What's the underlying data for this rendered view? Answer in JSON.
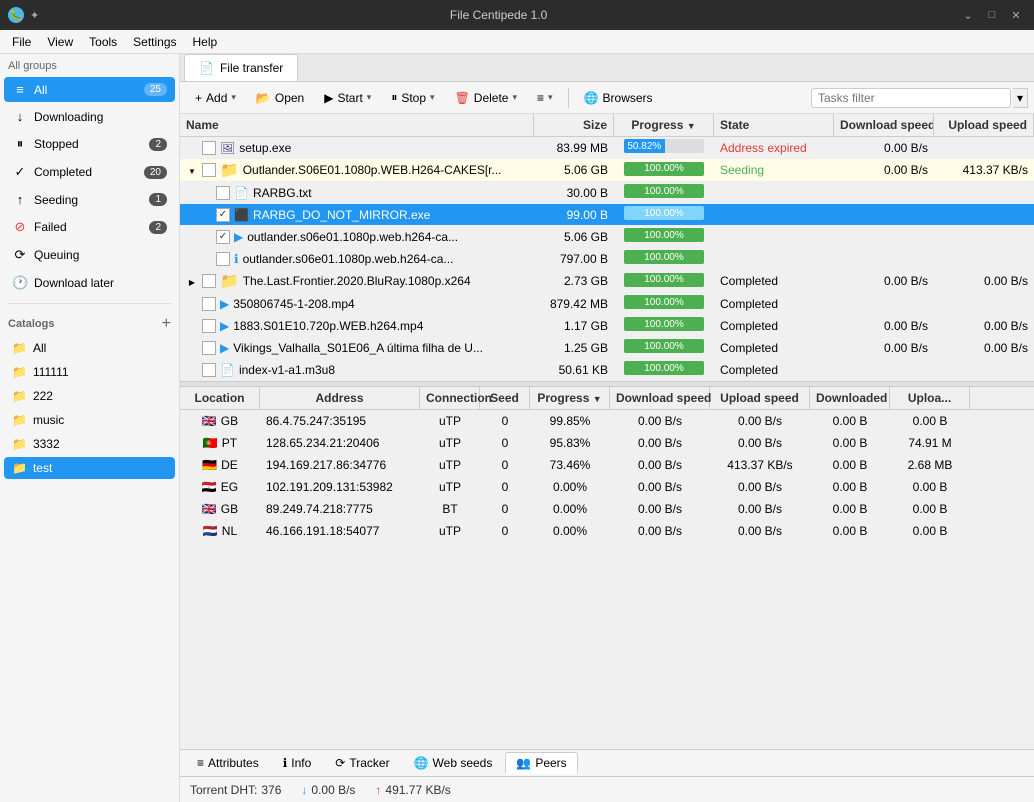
{
  "titleBar": {
    "title": "File Centipede 1.0",
    "controls": [
      "minimize",
      "maximize",
      "close"
    ]
  },
  "menuBar": {
    "items": [
      "File",
      "View",
      "Tools",
      "Settings",
      "Help"
    ]
  },
  "sidebar": {
    "groupLabel": "All groups",
    "navItems": [
      {
        "id": "all",
        "label": "All",
        "badge": "25",
        "active": true,
        "icon": "≡"
      },
      {
        "id": "downloading",
        "label": "Downloading",
        "badge": "",
        "active": false,
        "icon": "↓"
      },
      {
        "id": "stopped",
        "label": "Stopped",
        "badge": "2",
        "active": false,
        "icon": "⏸"
      },
      {
        "id": "completed",
        "label": "Completed",
        "badge": "20",
        "active": false,
        "icon": "✓"
      },
      {
        "id": "seeding",
        "label": "Seeding",
        "badge": "1",
        "active": false,
        "icon": "↑"
      },
      {
        "id": "failed",
        "label": "Failed",
        "badge": "2",
        "active": false,
        "icon": "⊘"
      },
      {
        "id": "queuing",
        "label": "Queuing",
        "badge": "",
        "active": false,
        "icon": "⟳"
      },
      {
        "id": "download-later",
        "label": "Download later",
        "badge": "",
        "active": false,
        "icon": "🕐"
      }
    ],
    "catalogs": {
      "title": "Catalogs",
      "addBtn": "+",
      "items": [
        {
          "id": "all",
          "label": "All",
          "active": false
        },
        {
          "id": "111111",
          "label": "111111",
          "active": false
        },
        {
          "id": "222",
          "label": "222",
          "active": false
        },
        {
          "id": "music",
          "label": "music",
          "active": false
        },
        {
          "id": "3332",
          "label": "3332",
          "active": false
        },
        {
          "id": "test",
          "label": "test",
          "active": true
        }
      ]
    }
  },
  "tab": {
    "label": "File transfer"
  },
  "toolbar": {
    "addLabel": "Add",
    "openLabel": "Open",
    "startLabel": "Start",
    "stopLabel": "Stop",
    "deleteLabel": "Delete",
    "moreLabel": "≡",
    "browsersLabel": "Browsers",
    "filterPlaceholder": "Tasks filter"
  },
  "tableHeaders": {
    "name": "Name",
    "size": "Size",
    "progress": "Progress",
    "state": "State",
    "dlSpeed": "Download speed",
    "ulSpeed": "Upload speed"
  },
  "tableRows": [
    {
      "id": 1,
      "indent": 0,
      "expand": false,
      "checkbox": false,
      "icon": "exe",
      "name": "setup.exe",
      "size": "83.99 MB",
      "progress": "50.82%",
      "progressVal": 50.82,
      "state": "Address expired",
      "dlSpeed": "0.00 B/s",
      "ulSpeed": "",
      "selected": false,
      "partial": true
    },
    {
      "id": 2,
      "indent": 0,
      "expand": true,
      "checkbox": false,
      "icon": "folder",
      "name": "Outlander.S06E01.1080p.WEB.H264-CAKES[r...",
      "size": "5.06 GB",
      "progress": "100.00%",
      "progressVal": 100,
      "state": "Seeding",
      "dlSpeed": "0.00 B/s",
      "ulSpeed": "413.37 KB/s",
      "selected": false,
      "partial": false
    },
    {
      "id": 3,
      "indent": 1,
      "expand": false,
      "checkbox": false,
      "icon": "text",
      "name": "RARBG.txt",
      "size": "30.00 B",
      "progress": "100.00%",
      "progressVal": 100,
      "state": "",
      "dlSpeed": "",
      "ulSpeed": "",
      "selected": false,
      "partial": false
    },
    {
      "id": 4,
      "indent": 1,
      "expand": false,
      "checkbox": true,
      "icon": "exe",
      "name": "RARBG_DO_NOT_MIRROR.exe",
      "size": "99.00 B",
      "progress": "100.00%",
      "progressVal": 100,
      "state": "",
      "dlSpeed": "",
      "ulSpeed": "",
      "selected": true,
      "partial": false
    },
    {
      "id": 5,
      "indent": 1,
      "expand": false,
      "checkbox": true,
      "icon": "video",
      "name": "outlander.s06e01.1080p.web.h264-ca...",
      "size": "5.06 GB",
      "progress": "100.00%",
      "progressVal": 100,
      "state": "",
      "dlSpeed": "",
      "ulSpeed": "",
      "selected": false,
      "partial": false
    },
    {
      "id": 6,
      "indent": 1,
      "expand": false,
      "checkbox": false,
      "icon": "info",
      "name": "outlander.s06e01.1080p.web.h264-ca...",
      "size": "797.00 B",
      "progress": "100.00%",
      "progressVal": 100,
      "state": "",
      "dlSpeed": "",
      "ulSpeed": "",
      "selected": false,
      "partial": false
    },
    {
      "id": 7,
      "indent": 0,
      "expand": true,
      "checkbox": false,
      "icon": "folder",
      "name": "The.Last.Frontier.2020.BluRay.1080p.x264",
      "size": "2.73 GB",
      "progress": "100.00%",
      "progressVal": 100,
      "state": "Completed",
      "dlSpeed": "0.00 B/s",
      "ulSpeed": "0.00 B/s",
      "selected": false,
      "partial": false
    },
    {
      "id": 8,
      "indent": 0,
      "expand": false,
      "checkbox": false,
      "icon": "video",
      "name": "350806745-1-208.mp4",
      "size": "879.42 MB",
      "progress": "100.00%",
      "progressVal": 100,
      "state": "Completed",
      "dlSpeed": "",
      "ulSpeed": "",
      "selected": false,
      "partial": false
    },
    {
      "id": 9,
      "indent": 0,
      "expand": false,
      "checkbox": false,
      "icon": "video",
      "name": "1883.S01E10.720p.WEB.h264.mp4",
      "size": "1.17 GB",
      "progress": "100.00%",
      "progressVal": 100,
      "state": "Completed",
      "dlSpeed": "0.00 B/s",
      "ulSpeed": "0.00 B/s",
      "selected": false,
      "partial": false
    },
    {
      "id": 10,
      "indent": 0,
      "expand": false,
      "checkbox": false,
      "icon": "video",
      "name": "Vikings_Valhalla_S01E06_A última filha de U...",
      "size": "1.25 GB",
      "progress": "100.00%",
      "progressVal": 100,
      "state": "Completed",
      "dlSpeed": "0.00 B/s",
      "ulSpeed": "0.00 B/s",
      "selected": false,
      "partial": false
    },
    {
      "id": 11,
      "indent": 0,
      "expand": false,
      "checkbox": false,
      "icon": "text",
      "name": "index-v1-a1.m3u8",
      "size": "50.61 KB",
      "progress": "100.00%",
      "progressVal": 100,
      "state": "Completed",
      "dlSpeed": "",
      "ulSpeed": "",
      "selected": false,
      "partial": false
    }
  ],
  "lowerTableHeaders": {
    "location": "Location",
    "address": "Address",
    "connection": "Connection",
    "seed": "Seed",
    "progress": "Progress",
    "dlSpeed": "Download speed",
    "ulSpeed": "Upload speed",
    "downloaded": "Downloaded",
    "uploaded": "Uploa..."
  },
  "lowerRows": [
    {
      "flag": "🇬🇧",
      "country": "GB",
      "address": "86.4.75.247:35195",
      "connection": "uTP",
      "seed": "0",
      "progress": "99.85%",
      "dlSpeed": "0.00 B/s",
      "ulSpeed": "0.00 B/s",
      "downloaded": "0.00 B",
      "uploaded": "0.00 B"
    },
    {
      "flag": "🇵🇹",
      "country": "PT",
      "address": "128.65.234.21:20406",
      "connection": "uTP",
      "seed": "0",
      "progress": "95.83%",
      "dlSpeed": "0.00 B/s",
      "ulSpeed": "0.00 B/s",
      "downloaded": "0.00 B",
      "uploaded": "74.91 M"
    },
    {
      "flag": "🇩🇪",
      "country": "DE",
      "address": "194.169.217.86:34776",
      "connection": "uTP",
      "seed": "0",
      "progress": "73.46%",
      "dlSpeed": "0.00 B/s",
      "ulSpeed": "413.37 KB/s",
      "downloaded": "0.00 B",
      "uploaded": "2.68 MB"
    },
    {
      "flag": "🇪🇬",
      "country": "EG",
      "address": "102.191.209.131:53982",
      "connection": "uTP",
      "seed": "0",
      "progress": "0.00%",
      "dlSpeed": "0.00 B/s",
      "ulSpeed": "0.00 B/s",
      "downloaded": "0.00 B",
      "uploaded": "0.00 B"
    },
    {
      "flag": "🇬🇧",
      "country": "GB",
      "address": "89.249.74.218:7775",
      "connection": "BT",
      "seed": "0",
      "progress": "0.00%",
      "dlSpeed": "0.00 B/s",
      "ulSpeed": "0.00 B/s",
      "downloaded": "0.00 B",
      "uploaded": "0.00 B"
    },
    {
      "flag": "🇳🇱",
      "country": "NL",
      "address": "46.166.191.18:54077",
      "connection": "uTP",
      "seed": "0",
      "progress": "0.00%",
      "dlSpeed": "0.00 B/s",
      "ulSpeed": "0.00 B/s",
      "downloaded": "0.00 B",
      "uploaded": "0.00 B"
    }
  ],
  "bottomTabs": [
    {
      "id": "attributes",
      "label": "Attributes",
      "icon": "≡",
      "active": false
    },
    {
      "id": "info",
      "label": "Info",
      "icon": "ℹ",
      "active": false
    },
    {
      "id": "tracker",
      "label": "Tracker",
      "icon": "⟳",
      "active": false
    },
    {
      "id": "webseeds",
      "label": "Web seeds",
      "icon": "🌐",
      "active": false
    },
    {
      "id": "peers",
      "label": "Peers",
      "icon": "👥",
      "active": true
    }
  ],
  "statusBar": {
    "dhtLabel": "Torrent DHT:",
    "dhtValue": "376",
    "downloadSpeed": "0.00 B/s",
    "uploadSpeed": "491.77 KB/s"
  }
}
